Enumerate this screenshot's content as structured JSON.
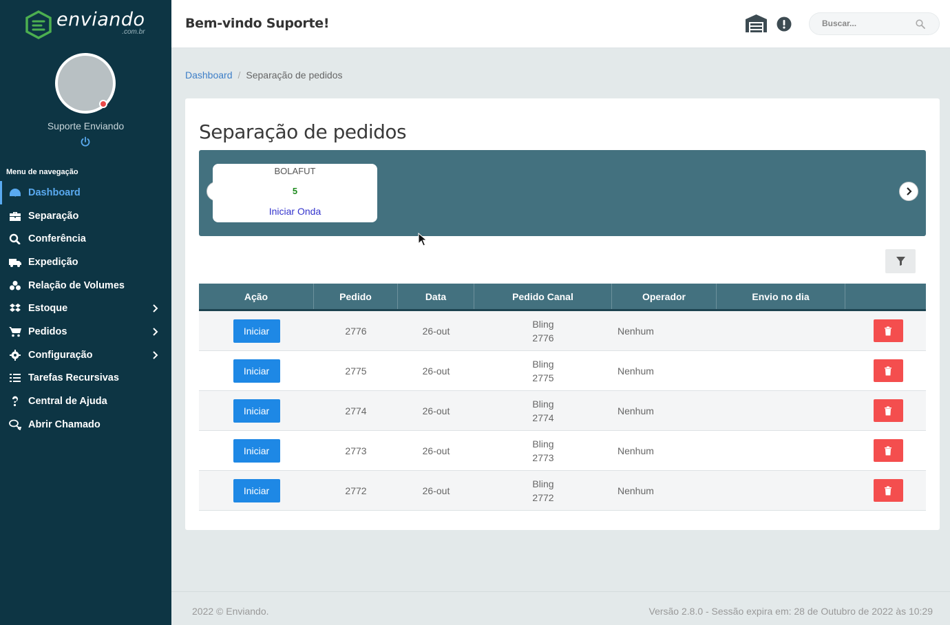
{
  "brand": {
    "name": "enviando",
    "sub": ".com.br"
  },
  "user": {
    "name": "Suporte Enviando"
  },
  "nav": {
    "title": "Menu de navegação",
    "items": [
      {
        "label": "Dashboard",
        "icon": "dashboard-icon",
        "active": true
      },
      {
        "label": "Separação",
        "icon": "briefcase-icon"
      },
      {
        "label": "Conferência",
        "icon": "search-icon"
      },
      {
        "label": "Expedição",
        "icon": "truck-icon"
      },
      {
        "label": "Relação de Volumes",
        "icon": "boxes-icon"
      },
      {
        "label": "Estoque",
        "icon": "dropbox-icon",
        "submenu": true
      },
      {
        "label": "Pedidos",
        "icon": "cart-icon",
        "submenu": true
      },
      {
        "label": "Configuração",
        "icon": "gear-icon",
        "submenu": true
      },
      {
        "label": "Tarefas Recursivas",
        "icon": "tasks-icon"
      },
      {
        "label": "Central de Ajuda",
        "icon": "question-icon"
      },
      {
        "label": "Abrir Chamado",
        "icon": "chat-icon"
      }
    ]
  },
  "header": {
    "welcome": "Bem-vindo Suporte!",
    "search_placeholder": "Buscar..."
  },
  "breadcrumb": {
    "home": "Dashboard",
    "separator": "/",
    "current": "Separação de pedidos"
  },
  "page": {
    "title": "Separação de pedidos"
  },
  "wave": {
    "name": "BOLAFUT",
    "count": "5",
    "action": "Iniciar Onda"
  },
  "table": {
    "headers": [
      "Ação",
      "Pedido",
      "Data",
      "Pedido Canal",
      "Operador",
      "Envio no dia",
      ""
    ],
    "rows": [
      {
        "action": "Iniciar",
        "pedido": "2776",
        "data": "26-out",
        "canal": "Bling",
        "canal_id": "2776",
        "operador": "Nenhum",
        "envio": ""
      },
      {
        "action": "Iniciar",
        "pedido": "2775",
        "data": "26-out",
        "canal": "Bling",
        "canal_id": "2775",
        "operador": "Nenhum",
        "envio": ""
      },
      {
        "action": "Iniciar",
        "pedido": "2774",
        "data": "26-out",
        "canal": "Bling",
        "canal_id": "2774",
        "operador": "Nenhum",
        "envio": ""
      },
      {
        "action": "Iniciar",
        "pedido": "2773",
        "data": "26-out",
        "canal": "Bling",
        "canal_id": "2773",
        "operador": "Nenhum",
        "envio": ""
      },
      {
        "action": "Iniciar",
        "pedido": "2772",
        "data": "26-out",
        "canal": "Bling",
        "canal_id": "2772",
        "operador": "Nenhum",
        "envio": ""
      }
    ]
  },
  "footer": {
    "copyright": "2022 © Enviando.",
    "version": "Versão 2.8.0 - Sessão expira em: 28 de Outubro de 2022 às 10:29"
  },
  "colors": {
    "sidebar": "#0d3544",
    "accent": "#5aaaf0",
    "table_header": "#43717f",
    "primary_button": "#1e88e5",
    "danger_button": "#f44e4e"
  }
}
